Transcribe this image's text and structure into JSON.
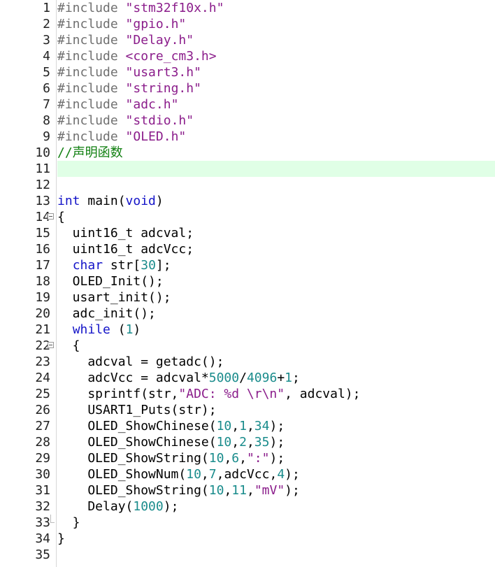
{
  "colors": {
    "preprocessor": "#707070",
    "string": "#8b1d8b",
    "keyword": "#1414c8",
    "number": "#1a8c8c",
    "comment": "#128012",
    "current_line_bg": "#e0ffe6"
  },
  "current_line": 11,
  "lines": [
    {
      "n": "1",
      "fold": "",
      "hl": false,
      "tokens": [
        [
          "pre",
          "#include "
        ],
        [
          "str",
          "\"stm32f10x.h\""
        ]
      ]
    },
    {
      "n": "2",
      "fold": "",
      "hl": false,
      "tokens": [
        [
          "pre",
          "#include "
        ],
        [
          "str",
          "\"gpio.h\""
        ]
      ]
    },
    {
      "n": "3",
      "fold": "",
      "hl": false,
      "tokens": [
        [
          "pre",
          "#include "
        ],
        [
          "str",
          "\"Delay.h\""
        ]
      ]
    },
    {
      "n": "4",
      "fold": "",
      "hl": false,
      "tokens": [
        [
          "pre",
          "#include "
        ],
        [
          "str",
          "<core_cm3.h>"
        ]
      ]
    },
    {
      "n": "5",
      "fold": "",
      "hl": false,
      "tokens": [
        [
          "pre",
          "#include "
        ],
        [
          "str",
          "\"usart3.h\""
        ]
      ]
    },
    {
      "n": "6",
      "fold": "",
      "hl": false,
      "tokens": [
        [
          "pre",
          "#include "
        ],
        [
          "str",
          "\"string.h\""
        ]
      ]
    },
    {
      "n": "7",
      "fold": "",
      "hl": false,
      "tokens": [
        [
          "pre",
          "#include "
        ],
        [
          "str",
          "\"adc.h\""
        ]
      ]
    },
    {
      "n": "8",
      "fold": "",
      "hl": false,
      "tokens": [
        [
          "pre",
          "#include "
        ],
        [
          "str",
          "\"stdio.h\""
        ]
      ]
    },
    {
      "n": "9",
      "fold": "",
      "hl": false,
      "tokens": [
        [
          "pre",
          "#include "
        ],
        [
          "str",
          "\"OLED.h\""
        ]
      ]
    },
    {
      "n": "10",
      "fold": "",
      "hl": false,
      "tokens": [
        [
          "cmt",
          "//声明函数"
        ]
      ]
    },
    {
      "n": "11",
      "fold": "",
      "hl": true,
      "tokens": []
    },
    {
      "n": "12",
      "fold": "",
      "hl": false,
      "tokens": []
    },
    {
      "n": "13",
      "fold": "",
      "hl": false,
      "tokens": [
        [
          "kw",
          "int"
        ],
        [
          "plain",
          " main("
        ],
        [
          "kw",
          "void"
        ],
        [
          "plain",
          ")"
        ]
      ]
    },
    {
      "n": "14",
      "fold": "box",
      "hl": false,
      "tokens": [
        [
          "plain",
          "{"
        ]
      ]
    },
    {
      "n": "15",
      "fold": "",
      "hl": false,
      "tokens": [
        [
          "plain",
          "  uint16_t adcval;"
        ]
      ]
    },
    {
      "n": "16",
      "fold": "",
      "hl": false,
      "tokens": [
        [
          "plain",
          "  uint16_t adcVcc;"
        ]
      ]
    },
    {
      "n": "17",
      "fold": "",
      "hl": false,
      "tokens": [
        [
          "plain",
          "  "
        ],
        [
          "kw",
          "char"
        ],
        [
          "plain",
          " str["
        ],
        [
          "num",
          "30"
        ],
        [
          "plain",
          "];"
        ]
      ]
    },
    {
      "n": "18",
      "fold": "",
      "hl": false,
      "tokens": [
        [
          "plain",
          "  OLED_Init();"
        ]
      ]
    },
    {
      "n": "19",
      "fold": "",
      "hl": false,
      "tokens": [
        [
          "plain",
          "  usart_init();"
        ]
      ]
    },
    {
      "n": "20",
      "fold": "",
      "hl": false,
      "tokens": [
        [
          "plain",
          "  adc_init();"
        ]
      ]
    },
    {
      "n": "21",
      "fold": "",
      "hl": false,
      "tokens": [
        [
          "plain",
          "  "
        ],
        [
          "kw",
          "while"
        ],
        [
          "plain",
          " ("
        ],
        [
          "num",
          "1"
        ],
        [
          "plain",
          ")"
        ]
      ]
    },
    {
      "n": "22",
      "fold": "box",
      "hl": false,
      "tokens": [
        [
          "plain",
          "  {"
        ]
      ]
    },
    {
      "n": "23",
      "fold": "",
      "hl": false,
      "tokens": [
        [
          "plain",
          "    adcval = getadc();"
        ]
      ]
    },
    {
      "n": "24",
      "fold": "",
      "hl": false,
      "tokens": [
        [
          "plain",
          "    adcVcc = adcval*"
        ],
        [
          "num",
          "5000"
        ],
        [
          "plain",
          "/"
        ],
        [
          "num",
          "4096"
        ],
        [
          "plain",
          "+"
        ],
        [
          "num",
          "1"
        ],
        [
          "plain",
          ";"
        ]
      ]
    },
    {
      "n": "25",
      "fold": "",
      "hl": false,
      "tokens": [
        [
          "plain",
          "    sprintf(str,"
        ],
        [
          "str",
          "\"ADC: %d \\r\\n\""
        ],
        [
          "plain",
          ", adcval);"
        ]
      ]
    },
    {
      "n": "26",
      "fold": "",
      "hl": false,
      "tokens": [
        [
          "plain",
          "    USART1_Puts(str);"
        ]
      ]
    },
    {
      "n": "27",
      "fold": "",
      "hl": false,
      "tokens": [
        [
          "plain",
          "    OLED_ShowChinese("
        ],
        [
          "num",
          "10"
        ],
        [
          "plain",
          ","
        ],
        [
          "num",
          "1"
        ],
        [
          "plain",
          ","
        ],
        [
          "num",
          "34"
        ],
        [
          "plain",
          ");"
        ]
      ]
    },
    {
      "n": "28",
      "fold": "",
      "hl": false,
      "tokens": [
        [
          "plain",
          "    OLED_ShowChinese("
        ],
        [
          "num",
          "10"
        ],
        [
          "plain",
          ","
        ],
        [
          "num",
          "2"
        ],
        [
          "plain",
          ","
        ],
        [
          "num",
          "35"
        ],
        [
          "plain",
          ");"
        ]
      ]
    },
    {
      "n": "29",
      "fold": "",
      "hl": false,
      "tokens": [
        [
          "plain",
          "    OLED_ShowString("
        ],
        [
          "num",
          "10"
        ],
        [
          "plain",
          ","
        ],
        [
          "num",
          "6"
        ],
        [
          "plain",
          ","
        ],
        [
          "str",
          "\":\""
        ],
        [
          "plain",
          ");"
        ]
      ]
    },
    {
      "n": "30",
      "fold": "",
      "hl": false,
      "tokens": [
        [
          "plain",
          "    OLED_ShowNum("
        ],
        [
          "num",
          "10"
        ],
        [
          "plain",
          ","
        ],
        [
          "num",
          "7"
        ],
        [
          "plain",
          ",adcVcc,"
        ],
        [
          "num",
          "4"
        ],
        [
          "plain",
          ");"
        ]
      ]
    },
    {
      "n": "31",
      "fold": "",
      "hl": false,
      "tokens": [
        [
          "plain",
          "    OLED_ShowString("
        ],
        [
          "num",
          "10"
        ],
        [
          "plain",
          ","
        ],
        [
          "num",
          "11"
        ],
        [
          "plain",
          ","
        ],
        [
          "str",
          "\"mV\""
        ],
        [
          "plain",
          ");"
        ]
      ]
    },
    {
      "n": "32",
      "fold": "",
      "hl": false,
      "tokens": [
        [
          "plain",
          "    Delay("
        ],
        [
          "num",
          "1000"
        ],
        [
          "plain",
          ");"
        ]
      ]
    },
    {
      "n": "33",
      "fold": "end",
      "hl": false,
      "tokens": [
        [
          "plain",
          "  }"
        ]
      ]
    },
    {
      "n": "34",
      "fold": "",
      "hl": false,
      "tokens": [
        [
          "plain",
          "}"
        ]
      ]
    },
    {
      "n": "35",
      "fold": "",
      "hl": false,
      "tokens": []
    }
  ]
}
